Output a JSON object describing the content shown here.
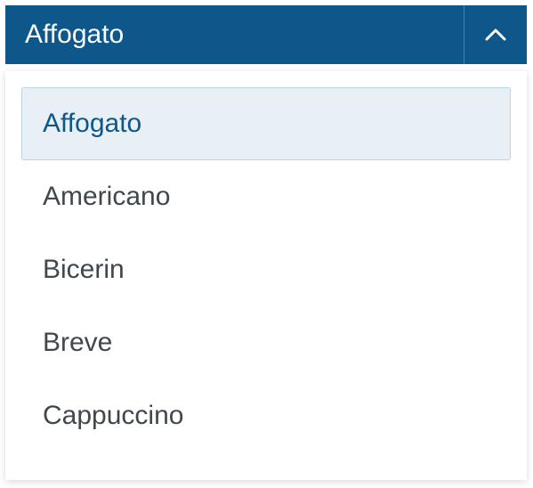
{
  "dropdown": {
    "selected": "Affogato",
    "items": [
      {
        "label": "Affogato",
        "highlighted": true
      },
      {
        "label": "Americano",
        "highlighted": false
      },
      {
        "label": "Bicerin",
        "highlighted": false
      },
      {
        "label": "Breve",
        "highlighted": false
      },
      {
        "label": "Cappuccino",
        "highlighted": false
      }
    ]
  }
}
